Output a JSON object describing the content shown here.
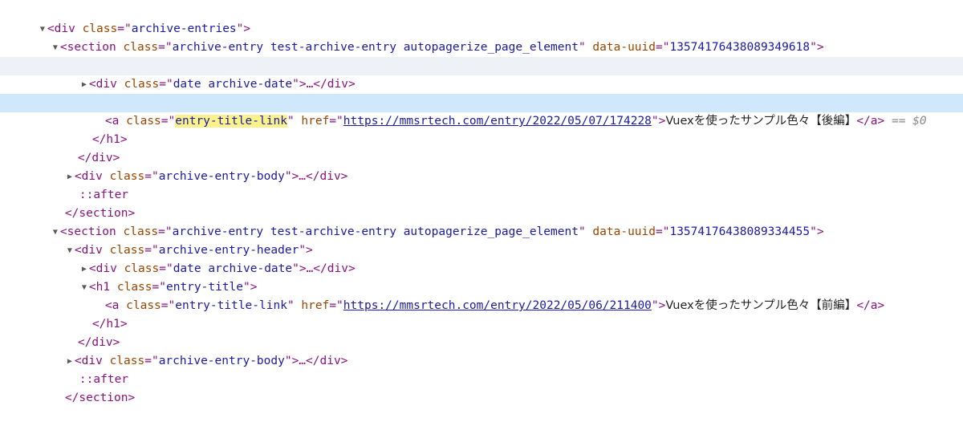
{
  "tokens": {
    "div_open": "<div",
    "div_close": "</div>",
    "section_open": "<section",
    "section_close": "</section>",
    "h1_open": "<h1",
    "h1_close": "</h1>",
    "a_open": "<a",
    "a_close": "</a>",
    "class_attr": "class",
    "href_attr": "href",
    "uuid_attr": "data-uuid",
    "eq_quote": "=\"",
    "quote": "\"",
    "gt": ">",
    "collapsed": ">…</div>",
    "after": "::after"
  },
  "classes": {
    "archive_entries": "archive-entries",
    "archive_entry": "archive-entry test-archive-entry autopagerize_page_element",
    "archive_entry_header": "archive-entry-header",
    "date_archive_date": "date archive-date",
    "entry_title": "entry-title",
    "entry_title_link": "entry-title-link",
    "archive_entry_body": "archive-entry-body"
  },
  "entries": [
    {
      "uuid": "13574176438089349618",
      "href": "https://mmsrtech.com/entry/2022/05/07/174228",
      "title": "Vuexを使ったサンプル色々【後編】"
    },
    {
      "uuid": "13574176438089334455",
      "href": "https://mmsrtech.com/entry/2022/05/06/211400",
      "title": "Vuexを使ったサンプル色々【前編】"
    }
  ],
  "selection_indicator": "== $0",
  "twisties": {
    "expanded": "▼",
    "collapsed": "▶"
  },
  "colors": {
    "tag": "#881280",
    "attr_name": "#994500",
    "attr_value": "#1a1aa6",
    "selected_row": "#cfe8fc",
    "hover_row": "#eef1f5",
    "search_highlight": "#fbf28b"
  }
}
